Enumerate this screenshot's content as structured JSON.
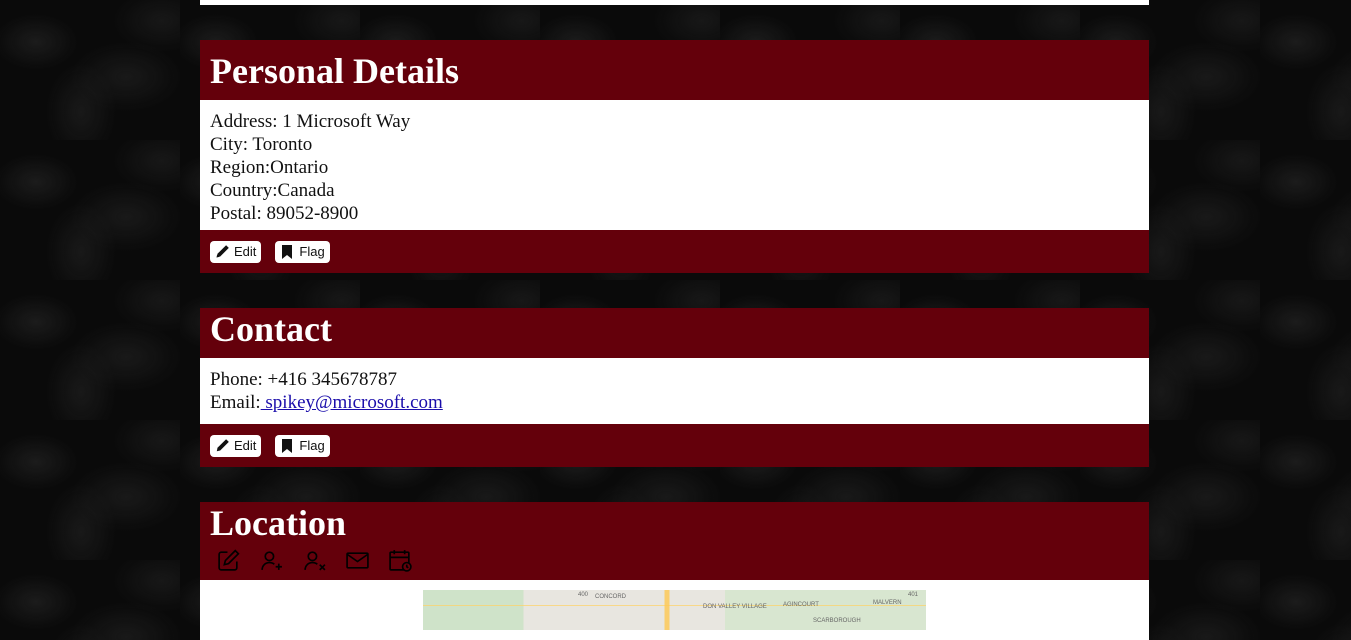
{
  "personal": {
    "title": "Personal Details",
    "address": "Address: 1 Microsoft Way",
    "city": "City: Toronto",
    "region": "Region:Ontario",
    "country": "Country:Canada",
    "postal": "Postal: 89052-8900",
    "edit_label": "Edit",
    "flag_label": "Flag"
  },
  "contact": {
    "title": "Contact",
    "phone": "Phone: +416 345678787",
    "email_prefix": "Email:",
    "email": " spikey@microsoft.com",
    "edit_label": "Edit",
    "flag_label": "Flag"
  },
  "location": {
    "title": "Location",
    "icons": [
      "edit-icon",
      "add-user-icon",
      "remove-user-icon",
      "mail-icon",
      "calendar-clock-icon"
    ],
    "map_labels": [
      "CONCORD",
      "DON VALLEY VILLAGE",
      "AGINCOURT",
      "MALVERN",
      "SCARBOROUGH",
      "400",
      "401"
    ]
  },
  "colors": {
    "header_bg": "#64000b",
    "panel_bg": "#ffffff",
    "link": "#1a0dab"
  }
}
